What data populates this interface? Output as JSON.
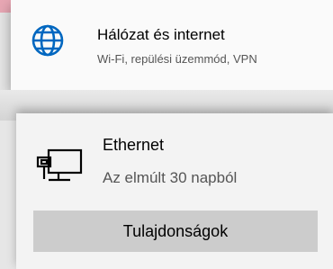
{
  "colors": {
    "accent": "#0067c0",
    "card_background": "#fafafa",
    "button_background": "#cccccc",
    "secondary_text": "#555555"
  },
  "network_card": {
    "icon": "globe-icon",
    "title": "Hálózat és internet",
    "subtitle": "Wi-Fi, repülési üzemmód, VPN"
  },
  "ethernet_card": {
    "icon": "ethernet-computer-icon",
    "title": "Ethernet",
    "subtitle": "Az elmúlt 30 napból",
    "properties_button": "Tulajdonságok"
  }
}
